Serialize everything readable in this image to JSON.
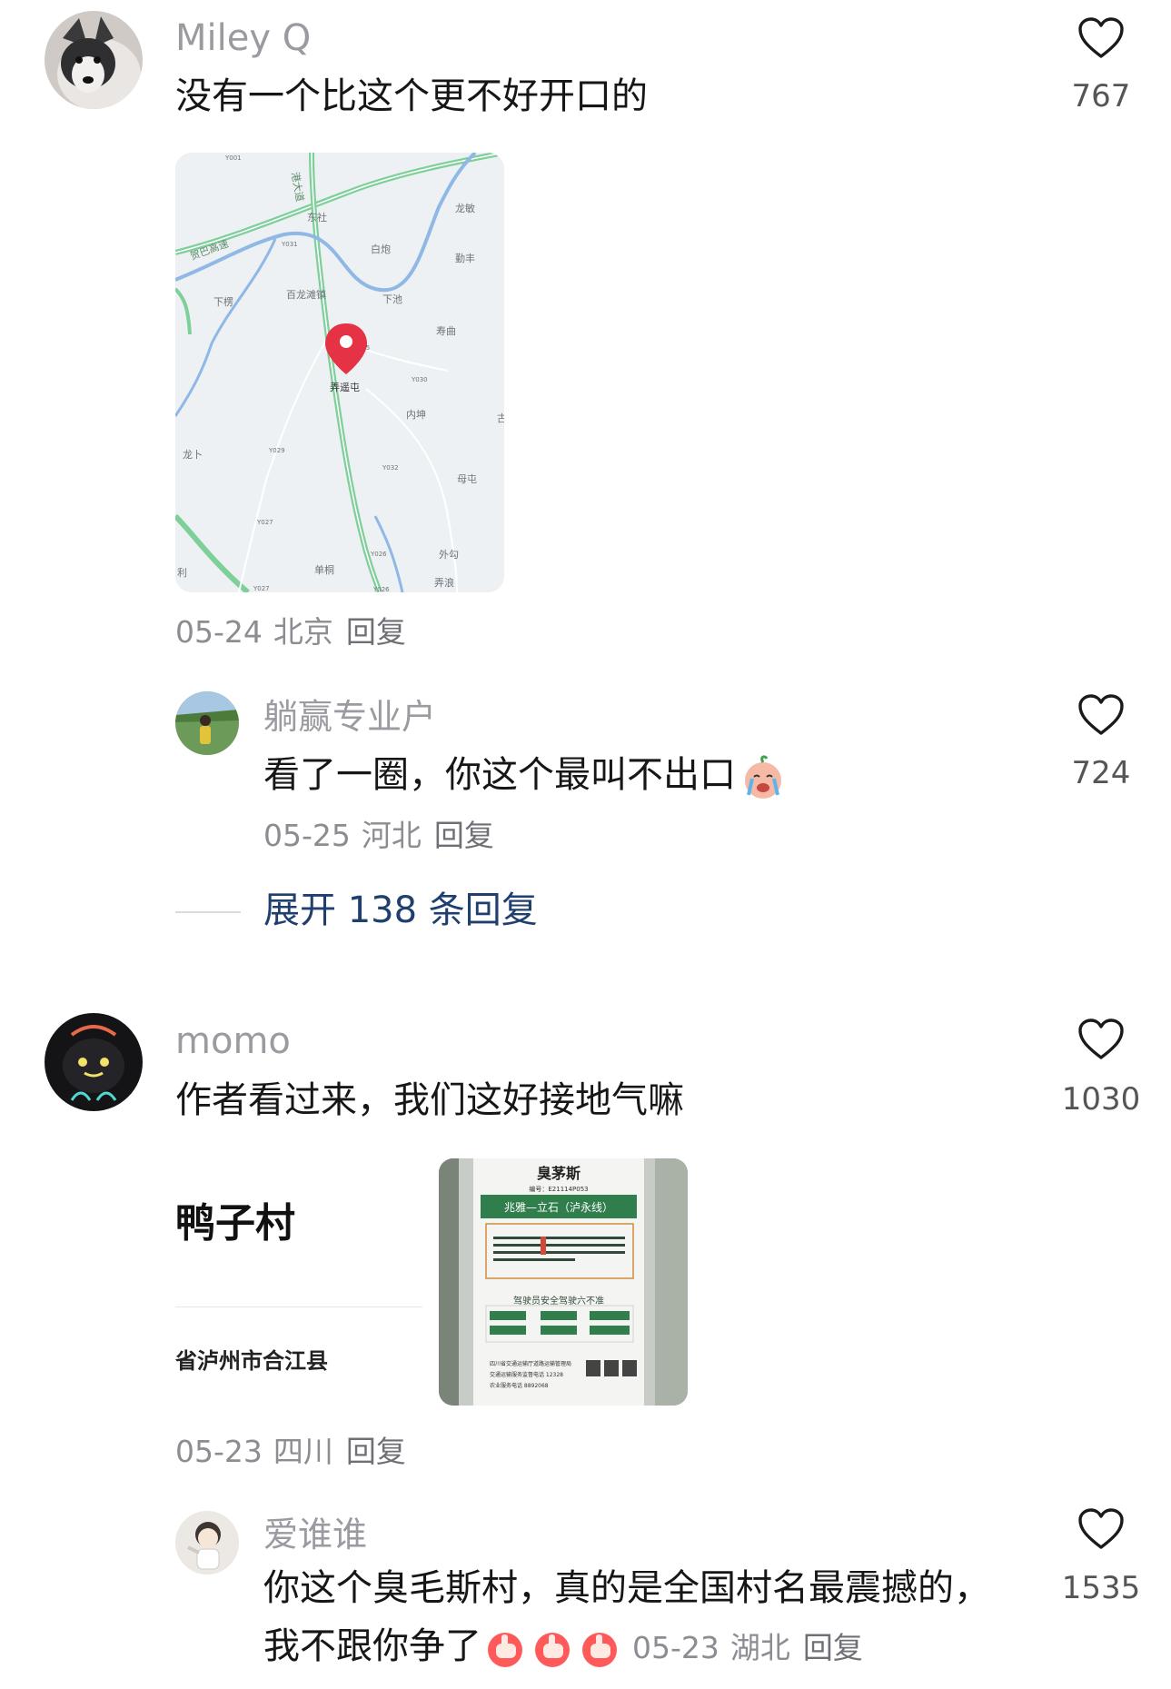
{
  "comments": [
    {
      "username": "Miley Q",
      "text": "没有一个比这个更不好开口的",
      "date": "05-24",
      "location": "北京",
      "reply_label": "回复",
      "likes": "767",
      "map": {
        "road_labels": [
          "Y001",
          "Y031",
          "X925",
          "Y030",
          "Y029",
          "Y032",
          "Y027",
          "Y026",
          "Y027",
          "Y026"
        ],
        "places": [
          "东社",
          "白炮",
          "龙敏",
          "勤丰",
          "贺巴高速",
          "下楞",
          "百龙滩镇",
          "下池",
          "寿曲",
          "弄遥屯",
          "内坤",
          "古",
          "龙卜",
          "母屯",
          "外勾",
          "单桐",
          "弄浪",
          "利",
          "港大道"
        ],
        "pin_label": "弄遥屯"
      },
      "reply": {
        "username": "躺赢专业户",
        "text": "看了一圈，你这个最叫不出口",
        "emoji": "crying-face-emoji",
        "date": "05-25",
        "location": "河北",
        "reply_label": "回复",
        "likes": "724"
      },
      "expand_label": "展开 138 条回复"
    },
    {
      "username": "momo",
      "text": "作者看过来，我们这好接地气嘛",
      "card": {
        "title": "鸭子村",
        "subtitle": "省泸州市合江县"
      },
      "sign": {
        "name": "臭茅斯",
        "code": "编号：E21114P053",
        "route": "兆雅—立石（泸永线）",
        "rule_title": "驾驶员安全驾驶六不准",
        "footer1": "四川省交通运输厅道路运输管理局",
        "footer2": "交通运输服务监督电话  12328",
        "footer3": "农业服务电话  8892068"
      },
      "date": "05-23",
      "location": "四川",
      "reply_label": "回复",
      "likes": "1030",
      "reply": {
        "username": "爱谁谁",
        "text_line1": "你这个臭毛斯村，真的是全国村名最震撼的，",
        "text_line2": "我不跟你争了",
        "emoji": "thumbs-up-emoji",
        "date": "05-23",
        "location": "湖北",
        "reply_label": "回复",
        "likes": "1535"
      }
    }
  ],
  "colors": {
    "username": "#9a9aa0",
    "text": "#161616",
    "expand_link": "#1f3f6e",
    "heart_outline": "#1a1a1a"
  }
}
